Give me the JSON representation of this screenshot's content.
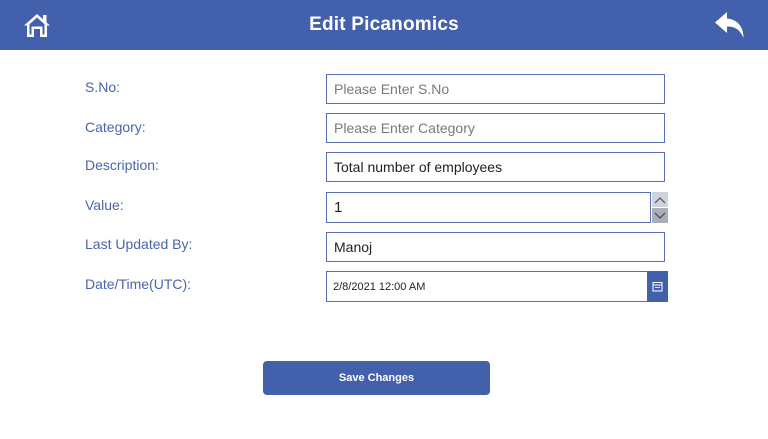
{
  "header": {
    "title": "Edit Picanomics",
    "home_icon": "home-icon",
    "back_icon": "back-arrow-icon",
    "bg_color": "#4360ad"
  },
  "form": {
    "sno": {
      "label": "S.No:",
      "value": "",
      "placeholder": "Please Enter S.No"
    },
    "category": {
      "label": "Category:",
      "value": "",
      "placeholder": "Please Enter Category"
    },
    "description": {
      "label": "Description:",
      "value": "Total number of employees"
    },
    "value": {
      "label": "Value:",
      "value": "1"
    },
    "last_updated_by": {
      "label": "Last Updated By:",
      "value": "Manoj"
    },
    "datetime": {
      "label": "Date/Time(UTC):",
      "value": "2/8/2021 12:00 AM",
      "icon": "calendar-icon"
    }
  },
  "actions": {
    "save_label": "Save Changes"
  },
  "colors": {
    "accent": "#4360ad",
    "label": "#4a64ae",
    "border": "#5a6fb0"
  }
}
